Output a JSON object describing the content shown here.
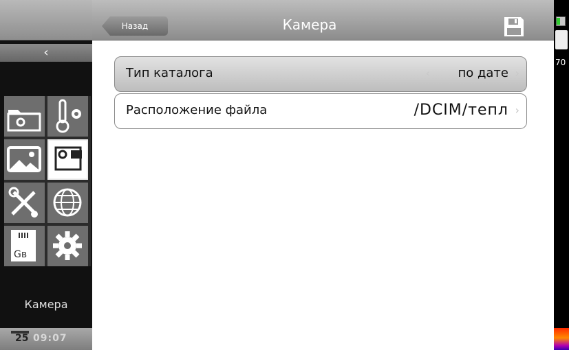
{
  "header": {
    "back_label": "Назад",
    "title": "Камера",
    "save_icon": "save-icon"
  },
  "sidebar": {
    "collapse_icon": "chevron-left-icon",
    "tiles": [
      {
        "icon": "folder-settings-icon"
      },
      {
        "icon": "thermometer-settings-icon"
      },
      {
        "icon": "image-icon"
      },
      {
        "icon": "camera-icon",
        "active": true
      },
      {
        "icon": "tools-icon"
      },
      {
        "icon": "globe-icon"
      },
      {
        "icon": "sd-card-icon",
        "text": "Gв"
      },
      {
        "icon": "gear-icon"
      }
    ],
    "section_label": "Камера",
    "date_day": "25",
    "time": "09:07"
  },
  "settings": {
    "catalog": {
      "label": "Тип каталога",
      "value": "по дате"
    },
    "location": {
      "label": "Расположение файла",
      "value": "/DCIM/тепл"
    }
  },
  "status": {
    "value": "70"
  }
}
